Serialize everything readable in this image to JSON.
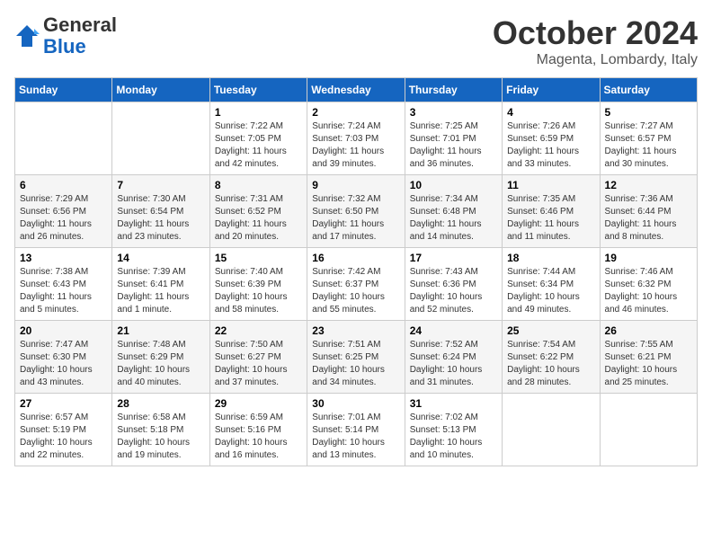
{
  "header": {
    "logo_general": "General",
    "logo_blue": "Blue",
    "month_title": "October 2024",
    "subtitle": "Magenta, Lombardy, Italy"
  },
  "days_of_week": [
    "Sunday",
    "Monday",
    "Tuesday",
    "Wednesday",
    "Thursday",
    "Friday",
    "Saturday"
  ],
  "weeks": [
    [
      {
        "day": "",
        "info": ""
      },
      {
        "day": "",
        "info": ""
      },
      {
        "day": "1",
        "info": "Sunrise: 7:22 AM\nSunset: 7:05 PM\nDaylight: 11 hours and 42 minutes."
      },
      {
        "day": "2",
        "info": "Sunrise: 7:24 AM\nSunset: 7:03 PM\nDaylight: 11 hours and 39 minutes."
      },
      {
        "day": "3",
        "info": "Sunrise: 7:25 AM\nSunset: 7:01 PM\nDaylight: 11 hours and 36 minutes."
      },
      {
        "day": "4",
        "info": "Sunrise: 7:26 AM\nSunset: 6:59 PM\nDaylight: 11 hours and 33 minutes."
      },
      {
        "day": "5",
        "info": "Sunrise: 7:27 AM\nSunset: 6:57 PM\nDaylight: 11 hours and 30 minutes."
      }
    ],
    [
      {
        "day": "6",
        "info": "Sunrise: 7:29 AM\nSunset: 6:56 PM\nDaylight: 11 hours and 26 minutes."
      },
      {
        "day": "7",
        "info": "Sunrise: 7:30 AM\nSunset: 6:54 PM\nDaylight: 11 hours and 23 minutes."
      },
      {
        "day": "8",
        "info": "Sunrise: 7:31 AM\nSunset: 6:52 PM\nDaylight: 11 hours and 20 minutes."
      },
      {
        "day": "9",
        "info": "Sunrise: 7:32 AM\nSunset: 6:50 PM\nDaylight: 11 hours and 17 minutes."
      },
      {
        "day": "10",
        "info": "Sunrise: 7:34 AM\nSunset: 6:48 PM\nDaylight: 11 hours and 14 minutes."
      },
      {
        "day": "11",
        "info": "Sunrise: 7:35 AM\nSunset: 6:46 PM\nDaylight: 11 hours and 11 minutes."
      },
      {
        "day": "12",
        "info": "Sunrise: 7:36 AM\nSunset: 6:44 PM\nDaylight: 11 hours and 8 minutes."
      }
    ],
    [
      {
        "day": "13",
        "info": "Sunrise: 7:38 AM\nSunset: 6:43 PM\nDaylight: 11 hours and 5 minutes."
      },
      {
        "day": "14",
        "info": "Sunrise: 7:39 AM\nSunset: 6:41 PM\nDaylight: 11 hours and 1 minute."
      },
      {
        "day": "15",
        "info": "Sunrise: 7:40 AM\nSunset: 6:39 PM\nDaylight: 10 hours and 58 minutes."
      },
      {
        "day": "16",
        "info": "Sunrise: 7:42 AM\nSunset: 6:37 PM\nDaylight: 10 hours and 55 minutes."
      },
      {
        "day": "17",
        "info": "Sunrise: 7:43 AM\nSunset: 6:36 PM\nDaylight: 10 hours and 52 minutes."
      },
      {
        "day": "18",
        "info": "Sunrise: 7:44 AM\nSunset: 6:34 PM\nDaylight: 10 hours and 49 minutes."
      },
      {
        "day": "19",
        "info": "Sunrise: 7:46 AM\nSunset: 6:32 PM\nDaylight: 10 hours and 46 minutes."
      }
    ],
    [
      {
        "day": "20",
        "info": "Sunrise: 7:47 AM\nSunset: 6:30 PM\nDaylight: 10 hours and 43 minutes."
      },
      {
        "day": "21",
        "info": "Sunrise: 7:48 AM\nSunset: 6:29 PM\nDaylight: 10 hours and 40 minutes."
      },
      {
        "day": "22",
        "info": "Sunrise: 7:50 AM\nSunset: 6:27 PM\nDaylight: 10 hours and 37 minutes."
      },
      {
        "day": "23",
        "info": "Sunrise: 7:51 AM\nSunset: 6:25 PM\nDaylight: 10 hours and 34 minutes."
      },
      {
        "day": "24",
        "info": "Sunrise: 7:52 AM\nSunset: 6:24 PM\nDaylight: 10 hours and 31 minutes."
      },
      {
        "day": "25",
        "info": "Sunrise: 7:54 AM\nSunset: 6:22 PM\nDaylight: 10 hours and 28 minutes."
      },
      {
        "day": "26",
        "info": "Sunrise: 7:55 AM\nSunset: 6:21 PM\nDaylight: 10 hours and 25 minutes."
      }
    ],
    [
      {
        "day": "27",
        "info": "Sunrise: 6:57 AM\nSunset: 5:19 PM\nDaylight: 10 hours and 22 minutes."
      },
      {
        "day": "28",
        "info": "Sunrise: 6:58 AM\nSunset: 5:18 PM\nDaylight: 10 hours and 19 minutes."
      },
      {
        "day": "29",
        "info": "Sunrise: 6:59 AM\nSunset: 5:16 PM\nDaylight: 10 hours and 16 minutes."
      },
      {
        "day": "30",
        "info": "Sunrise: 7:01 AM\nSunset: 5:14 PM\nDaylight: 10 hours and 13 minutes."
      },
      {
        "day": "31",
        "info": "Sunrise: 7:02 AM\nSunset: 5:13 PM\nDaylight: 10 hours and 10 minutes."
      },
      {
        "day": "",
        "info": ""
      },
      {
        "day": "",
        "info": ""
      }
    ]
  ]
}
